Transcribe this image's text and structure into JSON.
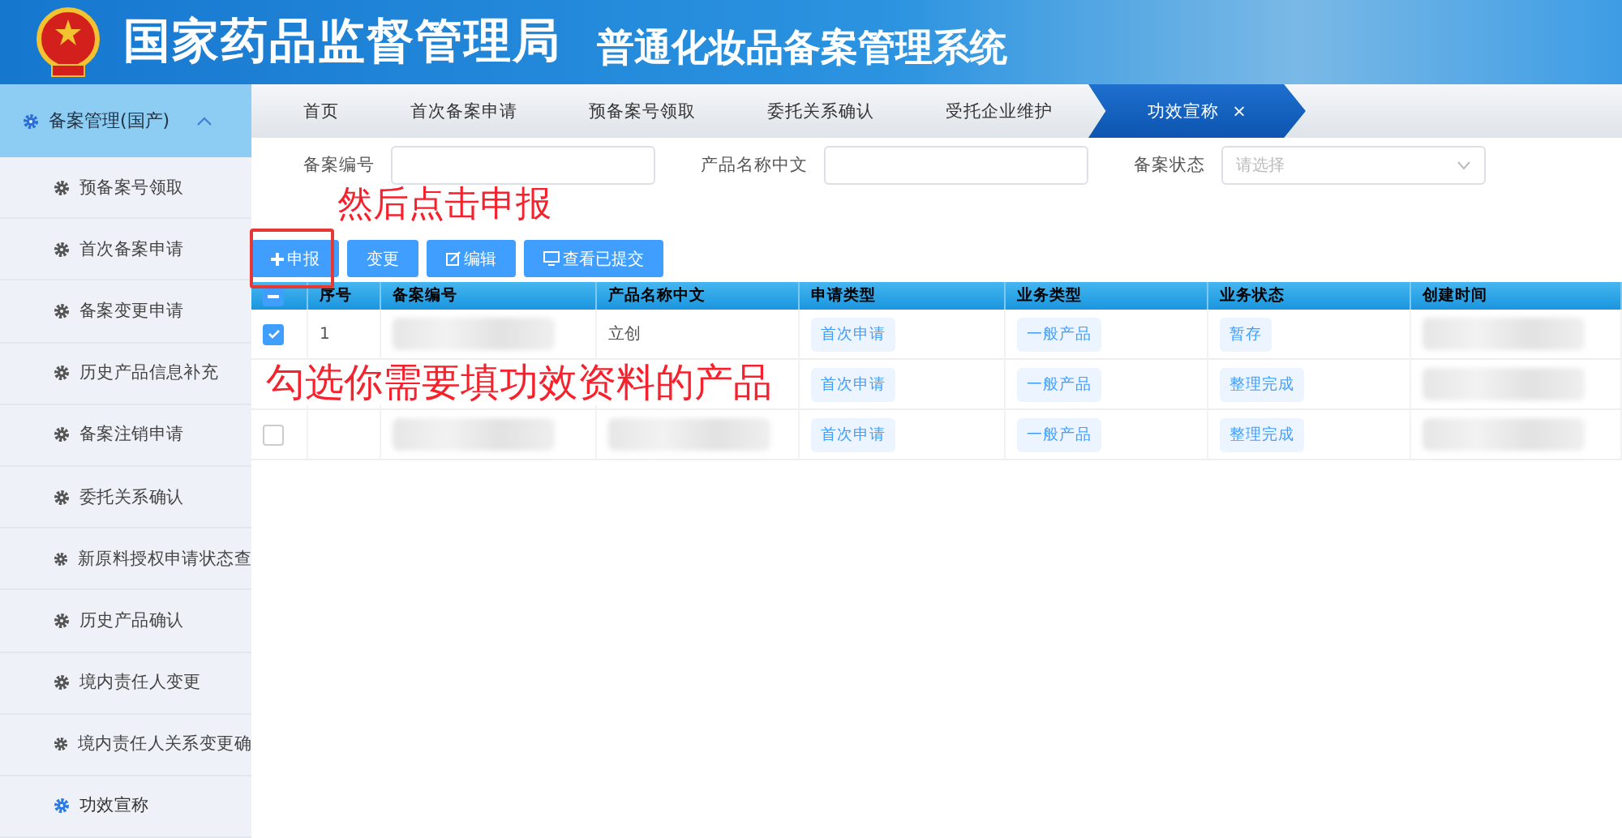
{
  "header": {
    "title": "国家药品监督管理局",
    "subtitle": "普通化妆品备案管理系统"
  },
  "sidebar": {
    "group": {
      "label": "备案管理(国产)",
      "expanded": true
    },
    "items": [
      {
        "label": "预备案号领取",
        "selected": false
      },
      {
        "label": "首次备案申请",
        "selected": false
      },
      {
        "label": "备案变更申请",
        "selected": false
      },
      {
        "label": "历史产品信息补充",
        "selected": false
      },
      {
        "label": "备案注销申请",
        "selected": false
      },
      {
        "label": "委托关系确认",
        "selected": false
      },
      {
        "label": "新原料授权申请状态查",
        "selected": false
      },
      {
        "label": "历史产品确认",
        "selected": false
      },
      {
        "label": "境内责任人变更",
        "selected": false
      },
      {
        "label": "境内责任人关系变更确",
        "selected": false
      },
      {
        "label": "功效宣称",
        "selected": true
      }
    ]
  },
  "tabs": [
    {
      "label": "首页",
      "selected": false
    },
    {
      "label": "首次备案申请",
      "selected": false
    },
    {
      "label": "预备案号领取",
      "selected": false
    },
    {
      "label": "委托关系确认",
      "selected": false
    },
    {
      "label": "受托企业维护",
      "selected": false
    },
    {
      "label": "功效宣称",
      "selected": true,
      "close": "×"
    }
  ],
  "filters": [
    {
      "kind": "input",
      "label": "备案编号"
    },
    {
      "kind": "input",
      "label": "产品名称中文"
    },
    {
      "kind": "select",
      "label": "备案状态",
      "placeholder": "请选择"
    }
  ],
  "buttons": [
    {
      "kind": "plus",
      "label": "申报",
      "highlighted": true
    },
    {
      "kind": "none",
      "label": "变更",
      "highlighted": false
    },
    {
      "kind": "edit",
      "label": "编辑",
      "highlighted": false
    },
    {
      "kind": "monitor",
      "label": "查看已提交",
      "highlighted": false
    }
  ],
  "annotations": [
    {
      "kind": "above-buttons",
      "text": "然后点击申报"
    },
    {
      "kind": "over-table",
      "text": "勾选你需要填功效资料的产品"
    }
  ],
  "table": {
    "select_all": {
      "indeterminate": true
    },
    "columns": [
      "序号",
      "备案编号",
      "产品名称中文",
      "申请类型",
      "业务类型",
      "业务状态",
      "创建时间"
    ],
    "rows": [
      {
        "checked": true,
        "cells": [
          {
            "kind": "text",
            "text": "1"
          },
          {
            "kind": "blurred"
          },
          {
            "kind": "text",
            "text": "立创"
          },
          {
            "kind": "tag",
            "text": "首次申请"
          },
          {
            "kind": "tag",
            "text": "一般产品"
          },
          {
            "kind": "tag",
            "text": "暂存"
          },
          {
            "kind": "blurred"
          }
        ]
      },
      {
        "cells": [
          {
            "kind": "empty"
          },
          {
            "kind": "empty"
          },
          {
            "kind": "empty"
          },
          {
            "kind": "tag",
            "text": "首次申请"
          },
          {
            "kind": "tag",
            "text": "一般产品"
          },
          {
            "kind": "tag",
            "text": "整理完成"
          },
          {
            "kind": "blurred"
          }
        ]
      },
      {
        "checked": false,
        "cells": [
          {
            "kind": "empty"
          },
          {
            "kind": "blurred"
          },
          {
            "kind": "blurred"
          },
          {
            "kind": "tag",
            "text": "首次申请"
          },
          {
            "kind": "tag",
            "text": "一般产品"
          },
          {
            "kind": "tag",
            "text": "整理完成"
          },
          {
            "kind": "blurred"
          }
        ]
      }
    ]
  }
}
